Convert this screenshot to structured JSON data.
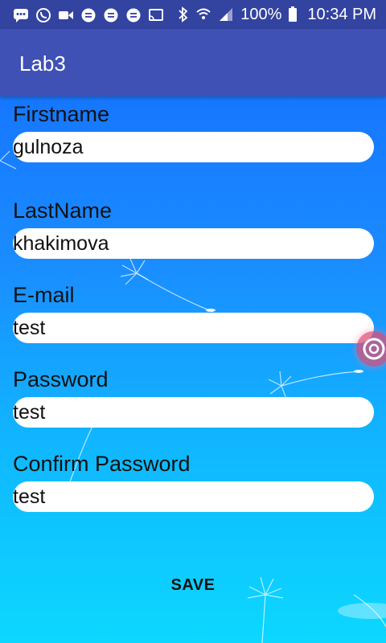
{
  "status_bar": {
    "battery_text": "100%",
    "time": "10:34 PM",
    "icons": [
      "messages-icon",
      "viber-icon",
      "video-icon",
      "chat-icon",
      "chat-icon",
      "chat-icon",
      "cast-icon",
      "bluetooth-icon",
      "wifi-icon",
      "signal-icon",
      "battery-icon"
    ]
  },
  "app": {
    "title": "Lab3"
  },
  "form": {
    "firstname": {
      "label": "Firstname",
      "value": "gulnoza"
    },
    "lastname": {
      "label": "LastName",
      "value": "khakimova"
    },
    "email": {
      "label": "E-mail",
      "value": "test"
    },
    "password": {
      "label": "Password",
      "value": "test"
    },
    "confirm_password": {
      "label": "Confirm Password",
      "value": "test"
    },
    "save_label": "SAVE"
  },
  "colors": {
    "status_bar": "#3343a0",
    "toolbar": "#3f51b5",
    "background_top": "#1677ff",
    "background_bottom": "#0cd8ff"
  }
}
